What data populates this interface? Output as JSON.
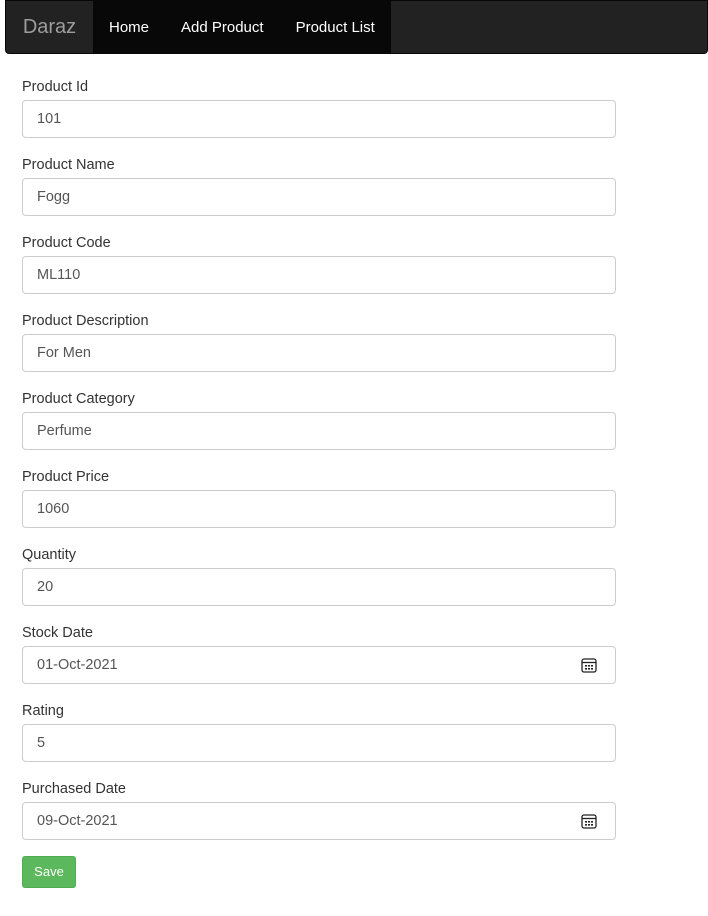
{
  "navbar": {
    "brand": "Daraz",
    "links": [
      "Home",
      "Add Product",
      "Product List"
    ]
  },
  "form": {
    "fields": [
      {
        "label": "Product Id",
        "value": "101"
      },
      {
        "label": "Product Name",
        "value": "Fogg"
      },
      {
        "label": "Product Code",
        "value": "ML110"
      },
      {
        "label": "Product Description",
        "value": "For Men"
      },
      {
        "label": "Product Category",
        "value": "Perfume"
      },
      {
        "label": "Product Price",
        "value": "1060"
      },
      {
        "label": "Quantity",
        "value": "20"
      },
      {
        "label": "Stock Date",
        "value": "01-Oct-2021",
        "icon": "calendar-icon"
      },
      {
        "label": "Rating",
        "value": "5"
      },
      {
        "label": "Purchased Date",
        "value": "09-Oct-2021",
        "icon": "calendar-icon"
      }
    ],
    "save_label": "Save"
  },
  "colors": {
    "navbar_bg": "#222222",
    "active_bg": "#080808",
    "save_button": "#5cb85c"
  }
}
